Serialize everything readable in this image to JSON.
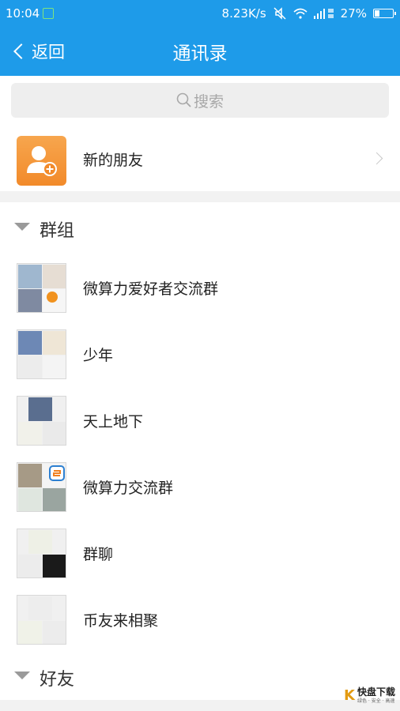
{
  "status_bar": {
    "time": "10:04",
    "speed": "8.23K/s",
    "battery": "27%",
    "battery_level": 0.27,
    "icons": [
      "app-icon",
      "mute-icon",
      "wifi-icon",
      "signal-icon",
      "battery-icon"
    ]
  },
  "nav": {
    "back_label": "返回",
    "title": "通讯录"
  },
  "search": {
    "placeholder": "搜索"
  },
  "new_friends": {
    "label": "新的朋友"
  },
  "sections": {
    "groups_label": "群组",
    "friends_label": "好友"
  },
  "groups": [
    {
      "name": "微算力爱好者交流群"
    },
    {
      "name": "少年"
    },
    {
      "name": "天上地下"
    },
    {
      "name": "微算力交流群"
    },
    {
      "name": "群聊"
    },
    {
      "name": "币友来相聚"
    }
  ],
  "watermark": {
    "brand_char": "K",
    "text": "快盘下载",
    "sub": "绿色 · 安全 · 高速"
  },
  "colors": {
    "primary": "#1e9be9",
    "new_friend_icon": "#f39a3a",
    "divider": "#f2f2f2"
  }
}
